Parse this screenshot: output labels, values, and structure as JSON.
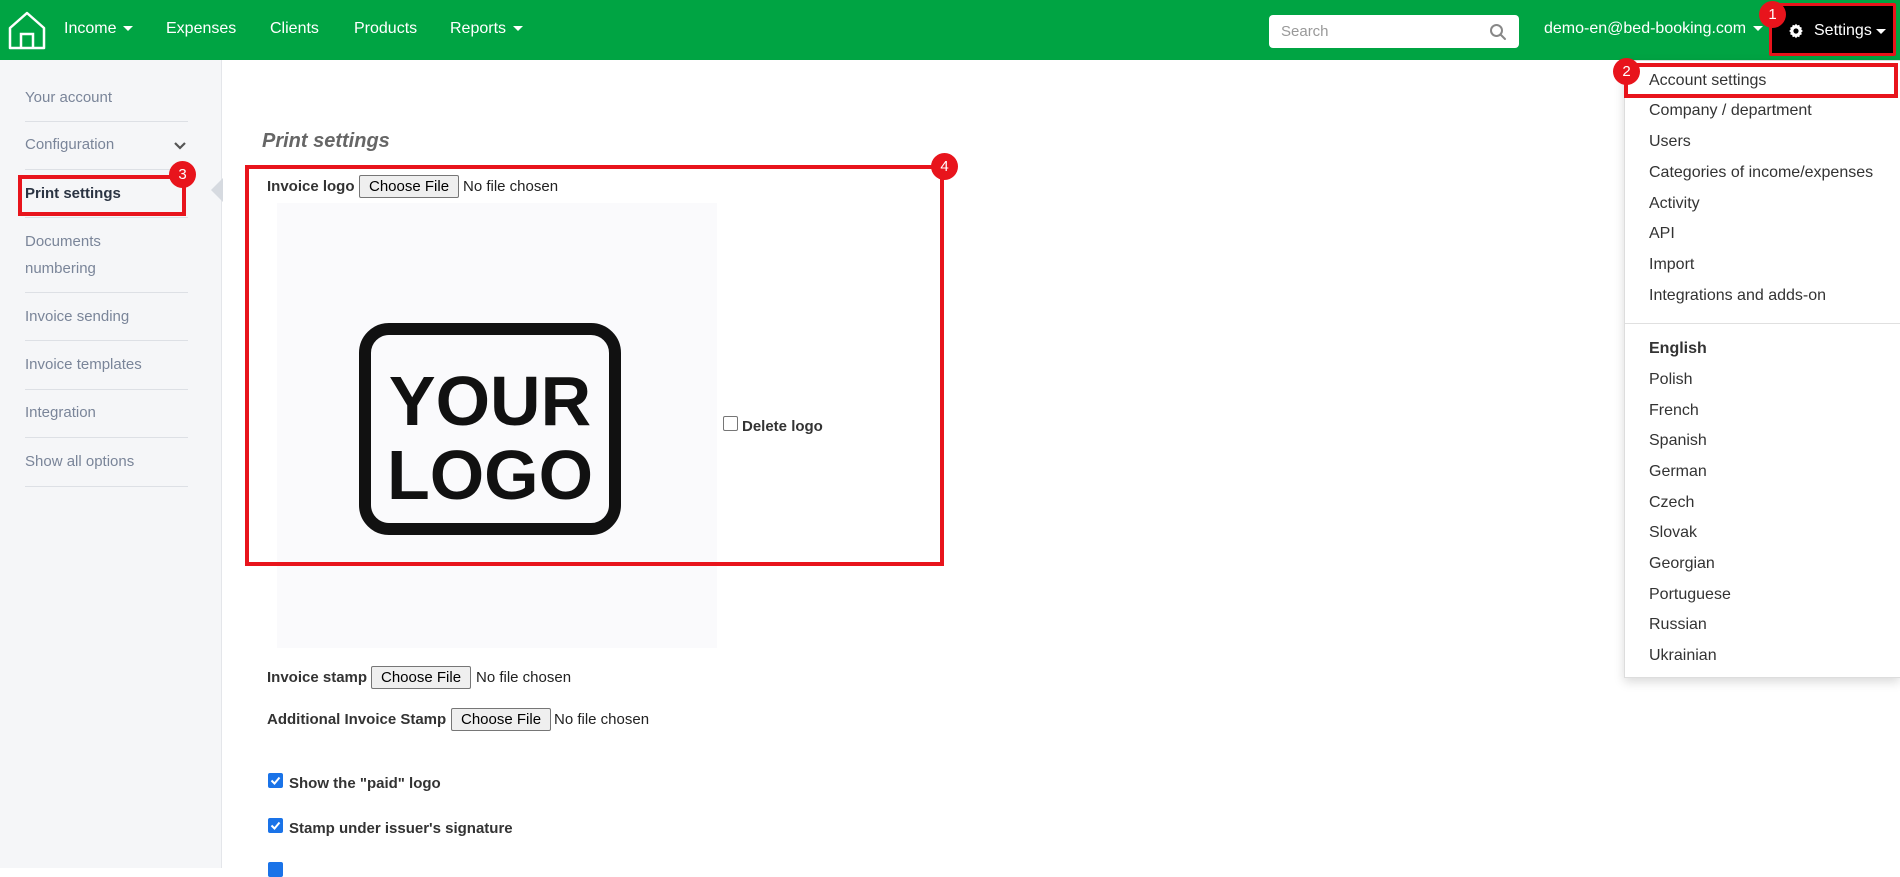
{
  "topbar": {
    "nav": [
      {
        "label": "Income",
        "dropdown": true
      },
      {
        "label": "Expenses",
        "dropdown": false
      },
      {
        "label": "Clients",
        "dropdown": false
      },
      {
        "label": "Products",
        "dropdown": false
      },
      {
        "label": "Reports",
        "dropdown": true
      }
    ],
    "search_placeholder": "Search",
    "user_email": "demo-en@bed-booking.com",
    "settings_label": "Settings"
  },
  "markers": [
    "1",
    "2",
    "3",
    "4"
  ],
  "sidebar": {
    "items": [
      "Your account",
      "Configuration",
      "Print settings",
      "Documents numbering",
      "Invoice sending",
      "Invoice templates",
      "Integration",
      "Show all options"
    ],
    "active": "Print settings"
  },
  "main": {
    "title": "Print settings",
    "invoice_logo_label": "Invoice logo",
    "choose_file_label": "Choose File",
    "no_file_text": "No file chosen",
    "logo_text_line1": "YOUR",
    "logo_text_line2": "LOGO",
    "delete_logo_label": "Delete logo",
    "invoice_stamp_label": "Invoice stamp",
    "additional_stamp_label": "Additional Invoice Stamp",
    "show_paid_logo_label": "Show the \"paid\" logo",
    "stamp_under_signature_label": "Stamp under issuer's signature"
  },
  "settings_menu": {
    "items": [
      "Account settings",
      "Company / department",
      "Users",
      "Categories of income/expenses",
      "Activity",
      "API",
      "Import",
      "Integrations and adds-on"
    ],
    "language_header": "English",
    "languages": [
      "Polish",
      "French",
      "Spanish",
      "German",
      "Czech",
      "Slovak",
      "Georgian",
      "Portuguese",
      "Russian",
      "Ukrainian"
    ]
  },
  "colors": {
    "topbar": "#00a443",
    "highlight": "#e8141c",
    "checkbox": "#1a73e8"
  }
}
